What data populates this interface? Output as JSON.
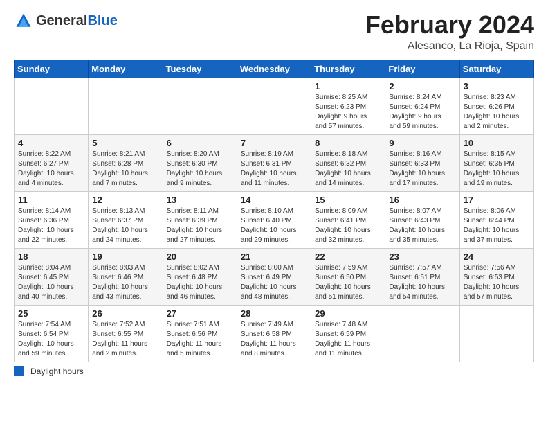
{
  "header": {
    "logo_general": "General",
    "logo_blue": "Blue",
    "month_title": "February 2024",
    "location": "Alesanco, La Rioja, Spain"
  },
  "days_of_week": [
    "Sunday",
    "Monday",
    "Tuesday",
    "Wednesday",
    "Thursday",
    "Friday",
    "Saturday"
  ],
  "footer": {
    "legend_label": "Daylight hours"
  },
  "weeks": [
    [
      {
        "num": "",
        "info": ""
      },
      {
        "num": "",
        "info": ""
      },
      {
        "num": "",
        "info": ""
      },
      {
        "num": "",
        "info": ""
      },
      {
        "num": "1",
        "info": "Sunrise: 8:25 AM\nSunset: 6:23 PM\nDaylight: 9 hours\nand 57 minutes."
      },
      {
        "num": "2",
        "info": "Sunrise: 8:24 AM\nSunset: 6:24 PM\nDaylight: 9 hours\nand 59 minutes."
      },
      {
        "num": "3",
        "info": "Sunrise: 8:23 AM\nSunset: 6:26 PM\nDaylight: 10 hours\nand 2 minutes."
      }
    ],
    [
      {
        "num": "4",
        "info": "Sunrise: 8:22 AM\nSunset: 6:27 PM\nDaylight: 10 hours\nand 4 minutes."
      },
      {
        "num": "5",
        "info": "Sunrise: 8:21 AM\nSunset: 6:28 PM\nDaylight: 10 hours\nand 7 minutes."
      },
      {
        "num": "6",
        "info": "Sunrise: 8:20 AM\nSunset: 6:30 PM\nDaylight: 10 hours\nand 9 minutes."
      },
      {
        "num": "7",
        "info": "Sunrise: 8:19 AM\nSunset: 6:31 PM\nDaylight: 10 hours\nand 11 minutes."
      },
      {
        "num": "8",
        "info": "Sunrise: 8:18 AM\nSunset: 6:32 PM\nDaylight: 10 hours\nand 14 minutes."
      },
      {
        "num": "9",
        "info": "Sunrise: 8:16 AM\nSunset: 6:33 PM\nDaylight: 10 hours\nand 17 minutes."
      },
      {
        "num": "10",
        "info": "Sunrise: 8:15 AM\nSunset: 6:35 PM\nDaylight: 10 hours\nand 19 minutes."
      }
    ],
    [
      {
        "num": "11",
        "info": "Sunrise: 8:14 AM\nSunset: 6:36 PM\nDaylight: 10 hours\nand 22 minutes."
      },
      {
        "num": "12",
        "info": "Sunrise: 8:13 AM\nSunset: 6:37 PM\nDaylight: 10 hours\nand 24 minutes."
      },
      {
        "num": "13",
        "info": "Sunrise: 8:11 AM\nSunset: 6:39 PM\nDaylight: 10 hours\nand 27 minutes."
      },
      {
        "num": "14",
        "info": "Sunrise: 8:10 AM\nSunset: 6:40 PM\nDaylight: 10 hours\nand 29 minutes."
      },
      {
        "num": "15",
        "info": "Sunrise: 8:09 AM\nSunset: 6:41 PM\nDaylight: 10 hours\nand 32 minutes."
      },
      {
        "num": "16",
        "info": "Sunrise: 8:07 AM\nSunset: 6:43 PM\nDaylight: 10 hours\nand 35 minutes."
      },
      {
        "num": "17",
        "info": "Sunrise: 8:06 AM\nSunset: 6:44 PM\nDaylight: 10 hours\nand 37 minutes."
      }
    ],
    [
      {
        "num": "18",
        "info": "Sunrise: 8:04 AM\nSunset: 6:45 PM\nDaylight: 10 hours\nand 40 minutes."
      },
      {
        "num": "19",
        "info": "Sunrise: 8:03 AM\nSunset: 6:46 PM\nDaylight: 10 hours\nand 43 minutes."
      },
      {
        "num": "20",
        "info": "Sunrise: 8:02 AM\nSunset: 6:48 PM\nDaylight: 10 hours\nand 46 minutes."
      },
      {
        "num": "21",
        "info": "Sunrise: 8:00 AM\nSunset: 6:49 PM\nDaylight: 10 hours\nand 48 minutes."
      },
      {
        "num": "22",
        "info": "Sunrise: 7:59 AM\nSunset: 6:50 PM\nDaylight: 10 hours\nand 51 minutes."
      },
      {
        "num": "23",
        "info": "Sunrise: 7:57 AM\nSunset: 6:51 PM\nDaylight: 10 hours\nand 54 minutes."
      },
      {
        "num": "24",
        "info": "Sunrise: 7:56 AM\nSunset: 6:53 PM\nDaylight: 10 hours\nand 57 minutes."
      }
    ],
    [
      {
        "num": "25",
        "info": "Sunrise: 7:54 AM\nSunset: 6:54 PM\nDaylight: 10 hours\nand 59 minutes."
      },
      {
        "num": "26",
        "info": "Sunrise: 7:52 AM\nSunset: 6:55 PM\nDaylight: 11 hours\nand 2 minutes."
      },
      {
        "num": "27",
        "info": "Sunrise: 7:51 AM\nSunset: 6:56 PM\nDaylight: 11 hours\nand 5 minutes."
      },
      {
        "num": "28",
        "info": "Sunrise: 7:49 AM\nSunset: 6:58 PM\nDaylight: 11 hours\nand 8 minutes."
      },
      {
        "num": "29",
        "info": "Sunrise: 7:48 AM\nSunset: 6:59 PM\nDaylight: 11 hours\nand 11 minutes."
      },
      {
        "num": "",
        "info": ""
      },
      {
        "num": "",
        "info": ""
      }
    ]
  ]
}
